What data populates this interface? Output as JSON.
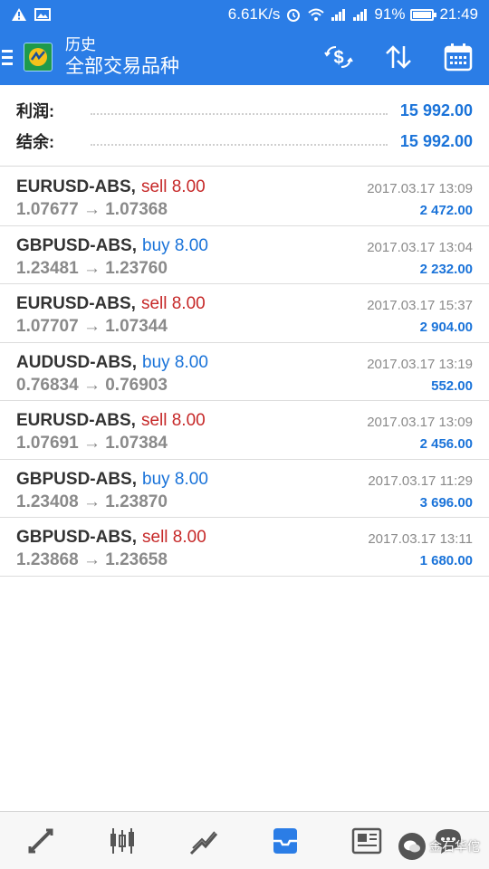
{
  "status_bar": {
    "speed": "6.61K/s",
    "battery": "91%",
    "battery_level": 0.91,
    "time": "21:49"
  },
  "app_bar": {
    "title": "历史",
    "subtitle": "全部交易品种"
  },
  "summary": {
    "profit_label": "利润:",
    "profit_value": "15 992.00",
    "balance_label": "结余:",
    "balance_value": "15 992.00"
  },
  "trades": [
    {
      "symbol": "EURUSD-ABS,",
      "side": "sell 8.00",
      "type": "sell",
      "prices": "1.07677 → 1.07368",
      "time": "2017.03.17 13:09",
      "profit": "2 472.00"
    },
    {
      "symbol": "GBPUSD-ABS,",
      "side": "buy 8.00",
      "type": "buy",
      "prices": "1.23481 → 1.23760",
      "time": "2017.03.17 13:04",
      "profit": "2 232.00"
    },
    {
      "symbol": "EURUSD-ABS,",
      "side": "sell 8.00",
      "type": "sell",
      "prices": "1.07707 → 1.07344",
      "time": "2017.03.17 15:37",
      "profit": "2 904.00"
    },
    {
      "symbol": "AUDUSD-ABS,",
      "side": "buy 8.00",
      "type": "buy",
      "prices": "0.76834 → 0.76903",
      "time": "2017.03.17 13:19",
      "profit": "552.00"
    },
    {
      "symbol": "EURUSD-ABS,",
      "side": "sell 8.00",
      "type": "sell",
      "prices": "1.07691 → 1.07384",
      "time": "2017.03.17 13:09",
      "profit": "2 456.00"
    },
    {
      "symbol": "GBPUSD-ABS,",
      "side": "buy 8.00",
      "type": "buy",
      "prices": "1.23408 → 1.23870",
      "time": "2017.03.17 11:29",
      "profit": "3 696.00"
    },
    {
      "symbol": "GBPUSD-ABS,",
      "side": "sell 8.00",
      "type": "sell",
      "prices": "1.23868 → 1.23658",
      "time": "2017.03.17 13:11",
      "profit": "1 680.00"
    }
  ],
  "bottom_nav": {
    "items": [
      "quotes-icon",
      "chart-icon",
      "trade-icon",
      "history-icon",
      "news-icon",
      "chat-icon"
    ]
  },
  "watermark": {
    "text": "金石华佗"
  },
  "colors": {
    "accent": "#2b7de6",
    "sell": "#c62828",
    "buy": "#1a73d9",
    "muted": "#8a8a8a"
  }
}
